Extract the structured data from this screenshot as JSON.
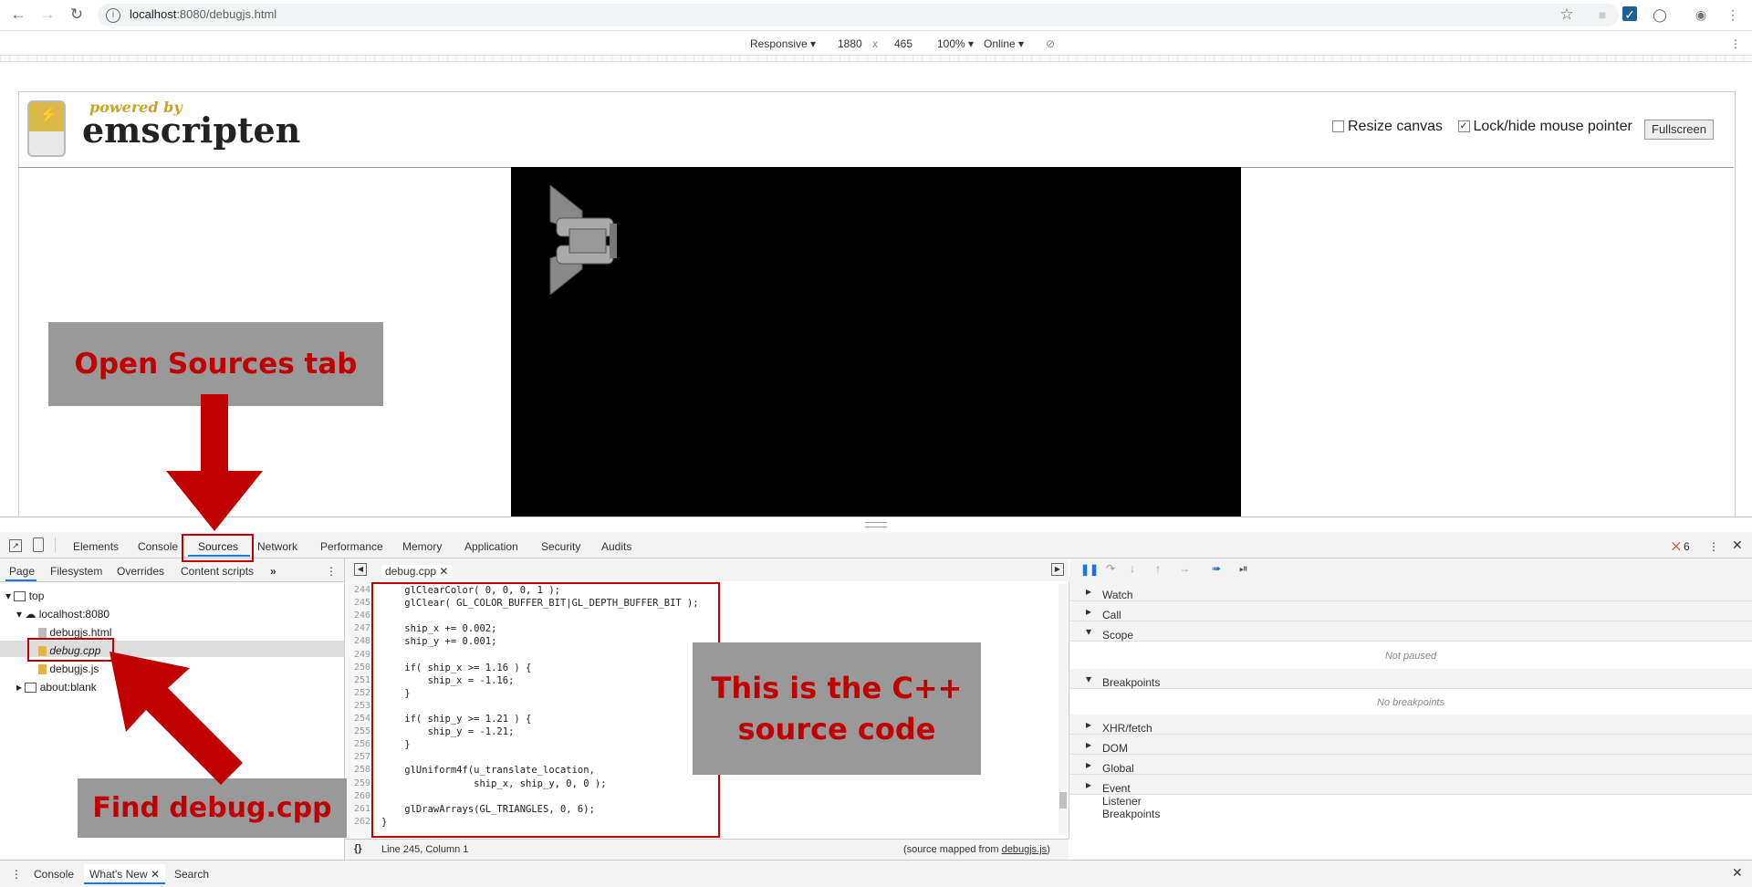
{
  "browser": {
    "url_host": "localhost",
    "url_rest": ":8080/debugjs.html"
  },
  "device_toolbar": {
    "mode": "Responsive",
    "width": "1880",
    "times": "x",
    "height": "465",
    "zoom": "100%",
    "network": "Online"
  },
  "page": {
    "logo_powered": "powered by",
    "logo_name": "emscripten",
    "resize_canvas_label": "Resize canvas",
    "lock_pointer_label": "Lock/hide mouse pointer",
    "fullscreen_label": "Fullscreen"
  },
  "devtools": {
    "tabs": [
      "Elements",
      "Console",
      "Sources",
      "Network",
      "Performance",
      "Memory",
      "Application",
      "Security",
      "Audits"
    ],
    "error_count": "6",
    "navigator_tabs": [
      "Page",
      "Filesystem",
      "Overrides",
      "Content scripts"
    ],
    "tree": {
      "top": "top",
      "host": "localhost:8080",
      "files": [
        "debugjs.html",
        "debug.cpp",
        "debugjs.js"
      ],
      "about": "about:blank"
    },
    "editor_tab": "debug.cpp",
    "line_numbers": [
      "244",
      "245",
      "246",
      "247",
      "248",
      "249",
      "250",
      "251",
      "252",
      "253",
      "254",
      "255",
      "256",
      "257",
      "258",
      "259",
      "260",
      "261",
      "262"
    ],
    "code_lines": [
      "    glClearColor( 0, 0, 0, 1 );",
      "    glClear( GL_COLOR_BUFFER_BIT|GL_DEPTH_BUFFER_BIT );",
      "",
      "    ship_x += 0.002;",
      "    ship_y += 0.001;",
      "",
      "    if( ship_x >= 1.16 ) {",
      "        ship_x = -1.16;",
      "    }",
      "",
      "    if( ship_y >= 1.21 ) {",
      "        ship_y = -1.21;",
      "    }",
      "",
      "    glUniform4f(u_translate_location,",
      "                ship_x, ship_y, 0, 0 );",
      "",
      "    glDrawArrays(GL_TRIANGLES, 0, 6);",
      "}"
    ],
    "status_position": "Line 245, Column 1",
    "status_mapped_prefix": "(source mapped from ",
    "status_mapped_link": "debugjs.js",
    "status_mapped_suffix": ")",
    "sections": {
      "watch": "Watch",
      "call_stack": "Call Stack",
      "scope": "Scope",
      "not_paused": "Not paused",
      "breakpoints": "Breakpoints",
      "no_breakpoints": "No breakpoints",
      "xhr": "XHR/fetch Breakpoints",
      "dom": "DOM Breakpoints",
      "global": "Global Listeners",
      "event": "Event Listener Breakpoints"
    },
    "drawer_tabs": [
      "Console",
      "What's New",
      "Search"
    ]
  },
  "annotations": {
    "open_sources": "Open Sources tab",
    "cpp_source_line1": "This is the C++",
    "cpp_source_line2": "source code",
    "find_cpp": "Find debug.cpp"
  },
  "colors": {
    "annotation_red": "#c00000",
    "annotation_gray": "#999999",
    "canvas_black": "#000000"
  }
}
